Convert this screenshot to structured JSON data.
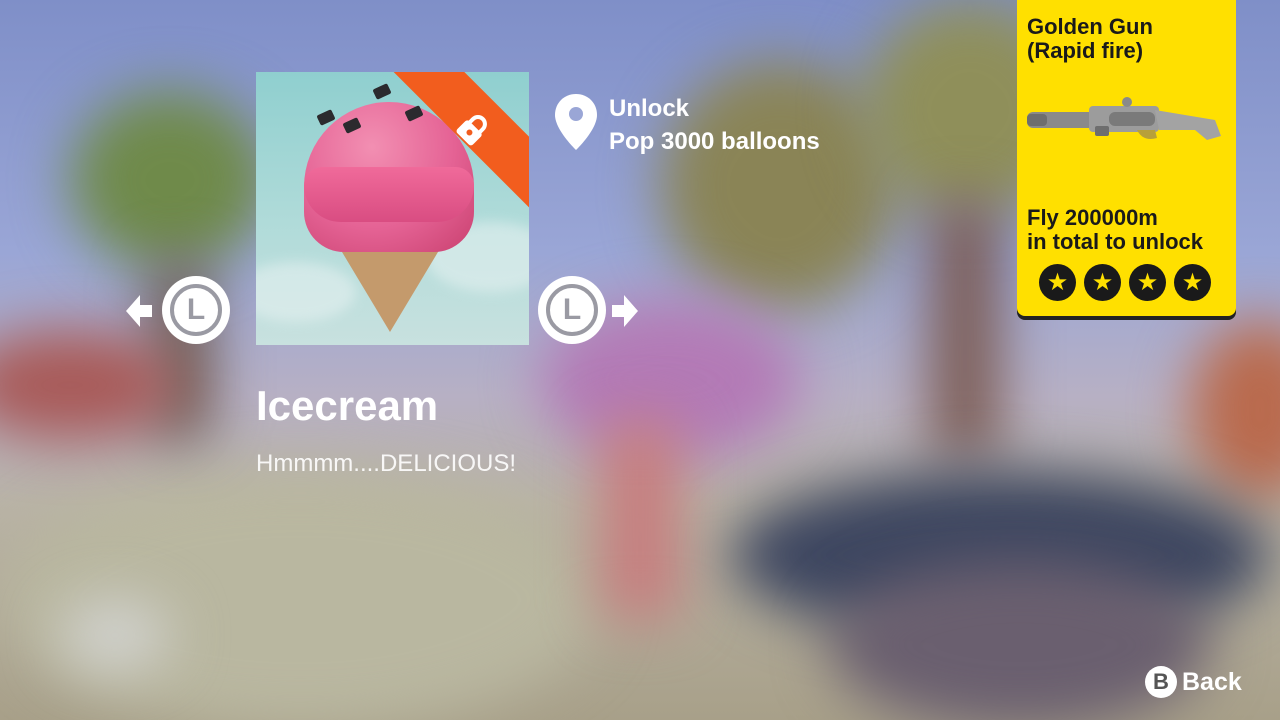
{
  "item": {
    "name": "Icecream",
    "description": "Hmmmm....DELICIOUS!",
    "locked": true
  },
  "unlock": {
    "label": "Unlock",
    "requirement": "Pop 3000 balloons",
    "icon": "location-pin-icon"
  },
  "navigation": {
    "prev_button": "L",
    "next_button": "L",
    "prev_icon": "arrow-left-icon",
    "next_icon": "arrow-right-icon"
  },
  "reward_panel": {
    "title_line1": "Golden Gun",
    "title_line2": "(Rapid fire)",
    "condition_line1": "Fly 200000m",
    "condition_line2": "in total to unlock",
    "stars": 4,
    "star_glyph": "★",
    "icon": "golden-gun-icon",
    "color": "#ffe000"
  },
  "footer": {
    "back_button_glyph": "B",
    "back_label": "Back"
  },
  "colors": {
    "lock_banner": "#f25d1e",
    "text": "#ffffff"
  }
}
